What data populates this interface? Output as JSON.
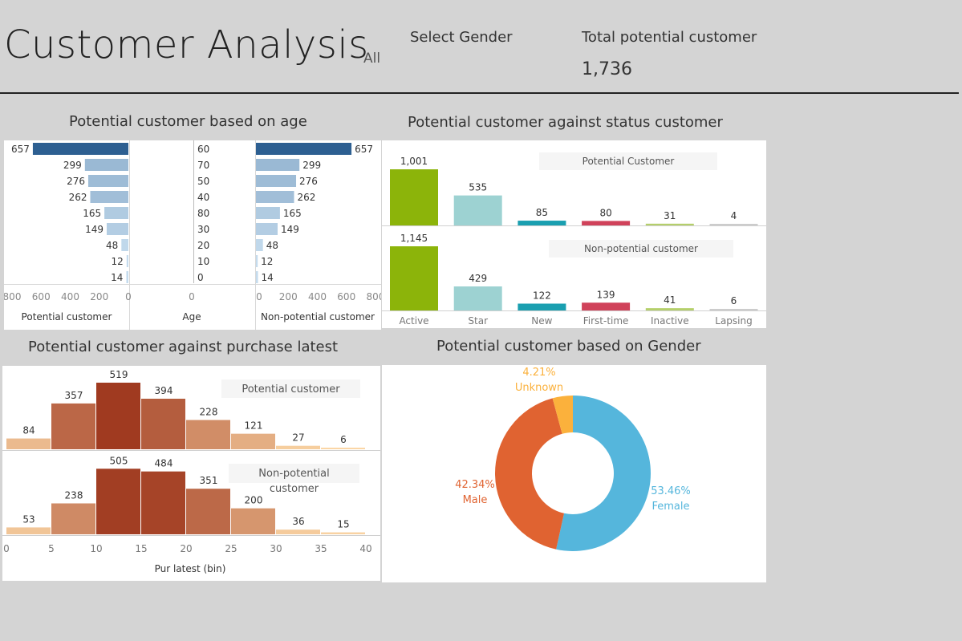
{
  "header": {
    "title": "Customer Analysis",
    "filter_value": "All",
    "select_gender_label": "Select Gender",
    "total_label": "Total potential customer",
    "total_value": "1,736"
  },
  "panels": {
    "age_title": "Potential customer based on age",
    "status_title": "Potential customer against status customer",
    "purchase_title": "Potential customer against purchase latest",
    "gender_title": "Potential customer based on Gender"
  },
  "chart_data": [
    {
      "id": "age",
      "type": "bar",
      "orientation": "horizontal",
      "categories": [
        "60",
        "70",
        "50",
        "40",
        "80",
        "30",
        "20",
        "10",
        "0"
      ],
      "series": [
        {
          "name": "Potential customer",
          "values": [
            657,
            299,
            276,
            262,
            165,
            149,
            48,
            12,
            14
          ]
        },
        {
          "name": "Non-potential customer",
          "values": [
            657,
            299,
            276,
            262,
            165,
            149,
            48,
            12,
            14
          ]
        }
      ],
      "xlabel_left": "Potential customer",
      "xlabel_center": "Age",
      "xlabel_right": "Non-potential customer",
      "center_tick": "0",
      "ticks_left": [
        "800",
        "600",
        "400",
        "200",
        "0"
      ],
      "ticks_right": [
        "0",
        "200",
        "400",
        "600",
        "800"
      ],
      "xlim": [
        0,
        800
      ]
    },
    {
      "id": "status",
      "type": "bar",
      "categories": [
        "Active",
        "Star",
        "New",
        "First-time",
        "Inactive",
        "Lapsing"
      ],
      "series": [
        {
          "name": "Potential Customer",
          "values": [
            1001,
            535,
            85,
            80,
            31,
            4
          ]
        },
        {
          "name": "Non-potential customer",
          "values": [
            1145,
            429,
            122,
            139,
            41,
            6
          ]
        }
      ],
      "value_labels": [
        [
          "1,001",
          "535",
          "85",
          "80",
          "31",
          "4"
        ],
        [
          "1,145",
          "429",
          "122",
          "139",
          "41",
          "6"
        ]
      ],
      "colors": [
        "#8cb40a",
        "#9dd2d2",
        "#1a9fb0",
        "#d0425a",
        "#b5cf6b",
        "#cccccc"
      ]
    },
    {
      "id": "purchase",
      "type": "bar",
      "histogram": true,
      "bins": [
        0,
        5,
        10,
        15,
        20,
        25,
        30,
        35
      ],
      "series": [
        {
          "name": "Potential customer",
          "values": [
            84,
            357,
            519,
            394,
            228,
            121,
            27,
            6
          ]
        },
        {
          "name": "Non-potential customer",
          "values": [
            53,
            238,
            505,
            484,
            351,
            200,
            36,
            15
          ]
        }
      ],
      "x_ticks": [
        "0",
        "5",
        "10",
        "15",
        "20",
        "25",
        "30",
        "35",
        "40"
      ],
      "xlabel": "Pur latest (bin)",
      "xlim": [
        0,
        40
      ],
      "color_low": "#fdd9a8",
      "color_high": "#a03a20"
    },
    {
      "id": "gender",
      "type": "pie",
      "donut": true,
      "slices": [
        {
          "label": "Female",
          "value": 53.46,
          "display": "53.46%",
          "color": "#55b6dc"
        },
        {
          "label": "Male",
          "value": 42.34,
          "display": "42.34%",
          "color": "#e06331"
        },
        {
          "label": "Unknown",
          "value": 4.21,
          "display": "4.21%",
          "color": "#fbb13c"
        }
      ]
    }
  ]
}
